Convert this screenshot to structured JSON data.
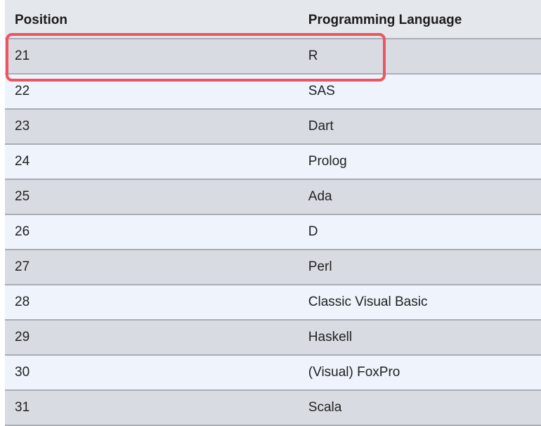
{
  "table": {
    "headers": [
      "Position",
      "Programming Language"
    ],
    "rows": [
      {
        "position": "21",
        "language": "R"
      },
      {
        "position": "22",
        "language": "SAS"
      },
      {
        "position": "23",
        "language": "Dart"
      },
      {
        "position": "24",
        "language": "Prolog"
      },
      {
        "position": "25",
        "language": "Ada"
      },
      {
        "position": "26",
        "language": "D"
      },
      {
        "position": "27",
        "language": "Perl"
      },
      {
        "position": "28",
        "language": "Classic Visual Basic"
      },
      {
        "position": "29",
        "language": "Haskell"
      },
      {
        "position": "30",
        "language": "(Visual) FoxPro"
      },
      {
        "position": "31",
        "language": "Scala"
      }
    ]
  },
  "colors": {
    "highlight": "#ee5563",
    "row_odd": "#d8dce2",
    "row_even": "#eef3fc"
  }
}
